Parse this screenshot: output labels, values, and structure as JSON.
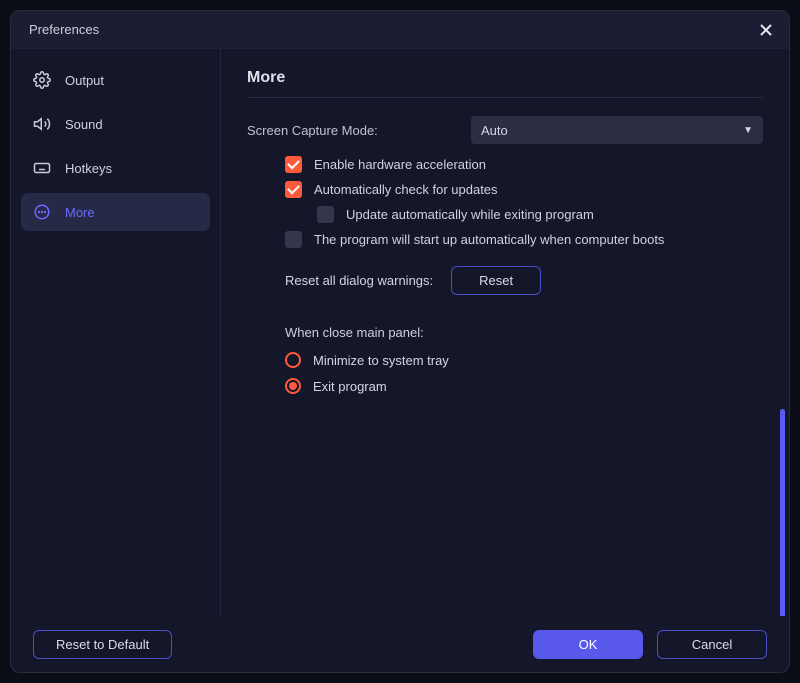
{
  "title": "Preferences",
  "sidebar": {
    "items": [
      {
        "label": "Output"
      },
      {
        "label": "Sound"
      },
      {
        "label": "Hotkeys"
      },
      {
        "label": "More"
      }
    ]
  },
  "section": {
    "title": "More",
    "screen_capture_label": "Screen Capture Mode:",
    "screen_capture_value": "Auto",
    "checks": {
      "hw_accel": "Enable hardware acceleration",
      "auto_update": "Automatically check for updates",
      "update_on_exit": "Update automatically while exiting program",
      "start_on_boot": "The program will start up automatically when computer boots"
    },
    "reset_label": "Reset all dialog warnings:",
    "reset_button": "Reset",
    "close_panel_label": "When close main panel:",
    "radios": {
      "tray": "Minimize to system tray",
      "exit": "Exit program"
    }
  },
  "footer": {
    "reset_default": "Reset to Default",
    "ok": "OK",
    "cancel": "Cancel"
  }
}
